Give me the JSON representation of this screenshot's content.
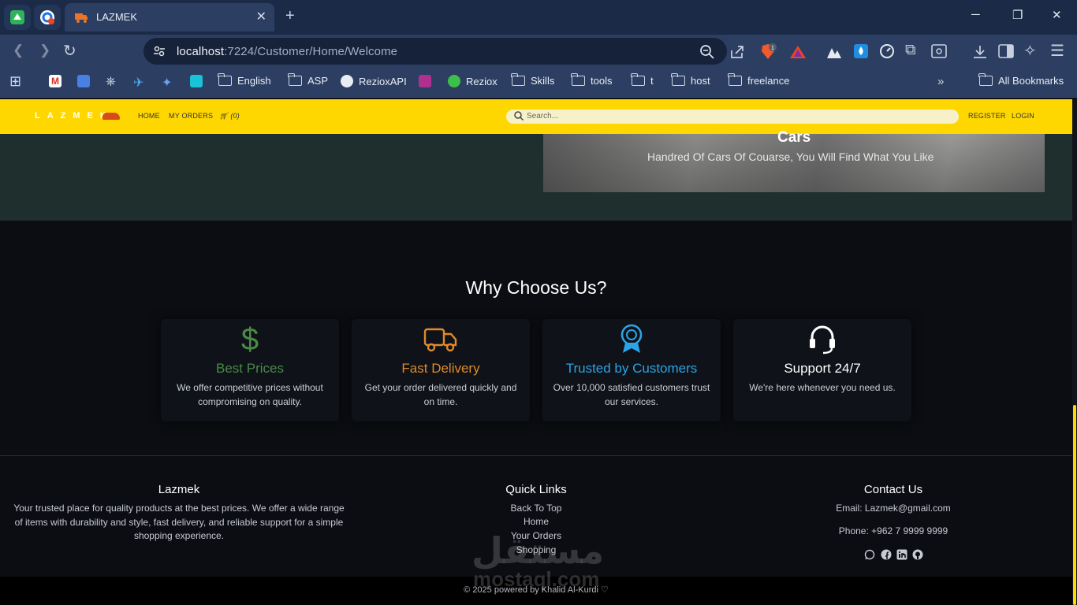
{
  "browser": {
    "tab_title": "LAZMEK",
    "url_host": "localhost",
    "url_rest": ":7224/Customer/Home/Welcome",
    "extension_badge": "1",
    "bookmarks": [
      "English",
      "ASP",
      "RezioxAPI",
      "Reziox",
      "Skills",
      "tools",
      "t",
      "host",
      "freelance"
    ],
    "all_bookmarks": "All Bookmarks"
  },
  "nav": {
    "logo": "LAZMEK",
    "home": "HOME",
    "orders": "MY ORDERS",
    "cart_count": "(0)",
    "search_placeholder": "Search...",
    "register": "REGISTER",
    "login": "LOGIN"
  },
  "hero": {
    "title": "Cars",
    "subtitle": "Handred Of Cars Of Couarse, You Will Find What You Like"
  },
  "why": {
    "title": "Why Choose Us?",
    "cards": [
      {
        "title": "Best Prices",
        "desc": "We offer competitive prices without compromising on quality.",
        "color": "#4a8a46",
        "icon": "dollar-icon"
      },
      {
        "title": "Fast Delivery",
        "desc": "Get your order delivered quickly and on time.",
        "color": "#e08a2a",
        "icon": "truck-icon"
      },
      {
        "title": "Trusted by Customers",
        "desc": "Over 10,000 satisfied customers trust our services.",
        "color": "#2aa4e6",
        "icon": "award-icon"
      },
      {
        "title": "Support 24/7",
        "desc": "We're here whenever you need us.",
        "color": "#ffffff",
        "icon": "headset-icon"
      }
    ]
  },
  "footer": {
    "about_title": "Lazmek",
    "about_text": "Your trusted place for quality products at the best prices. We offer a wide range of items with durability and style, fast delivery, and reliable support for a simple shopping experience.",
    "links_title": "Quick Links",
    "links": [
      "Back To Top",
      "Home",
      "Your Orders",
      "Shopping"
    ],
    "contact_title": "Contact Us",
    "email": "Email: Lazmek@gmail.com",
    "phone": "Phone: +962 7 9999 9999",
    "copyright": "© 2025 powered by Khalid Al-Kurdi ♡",
    "watermark": "مستقل",
    "watermark_domain": "mostaql.com"
  }
}
